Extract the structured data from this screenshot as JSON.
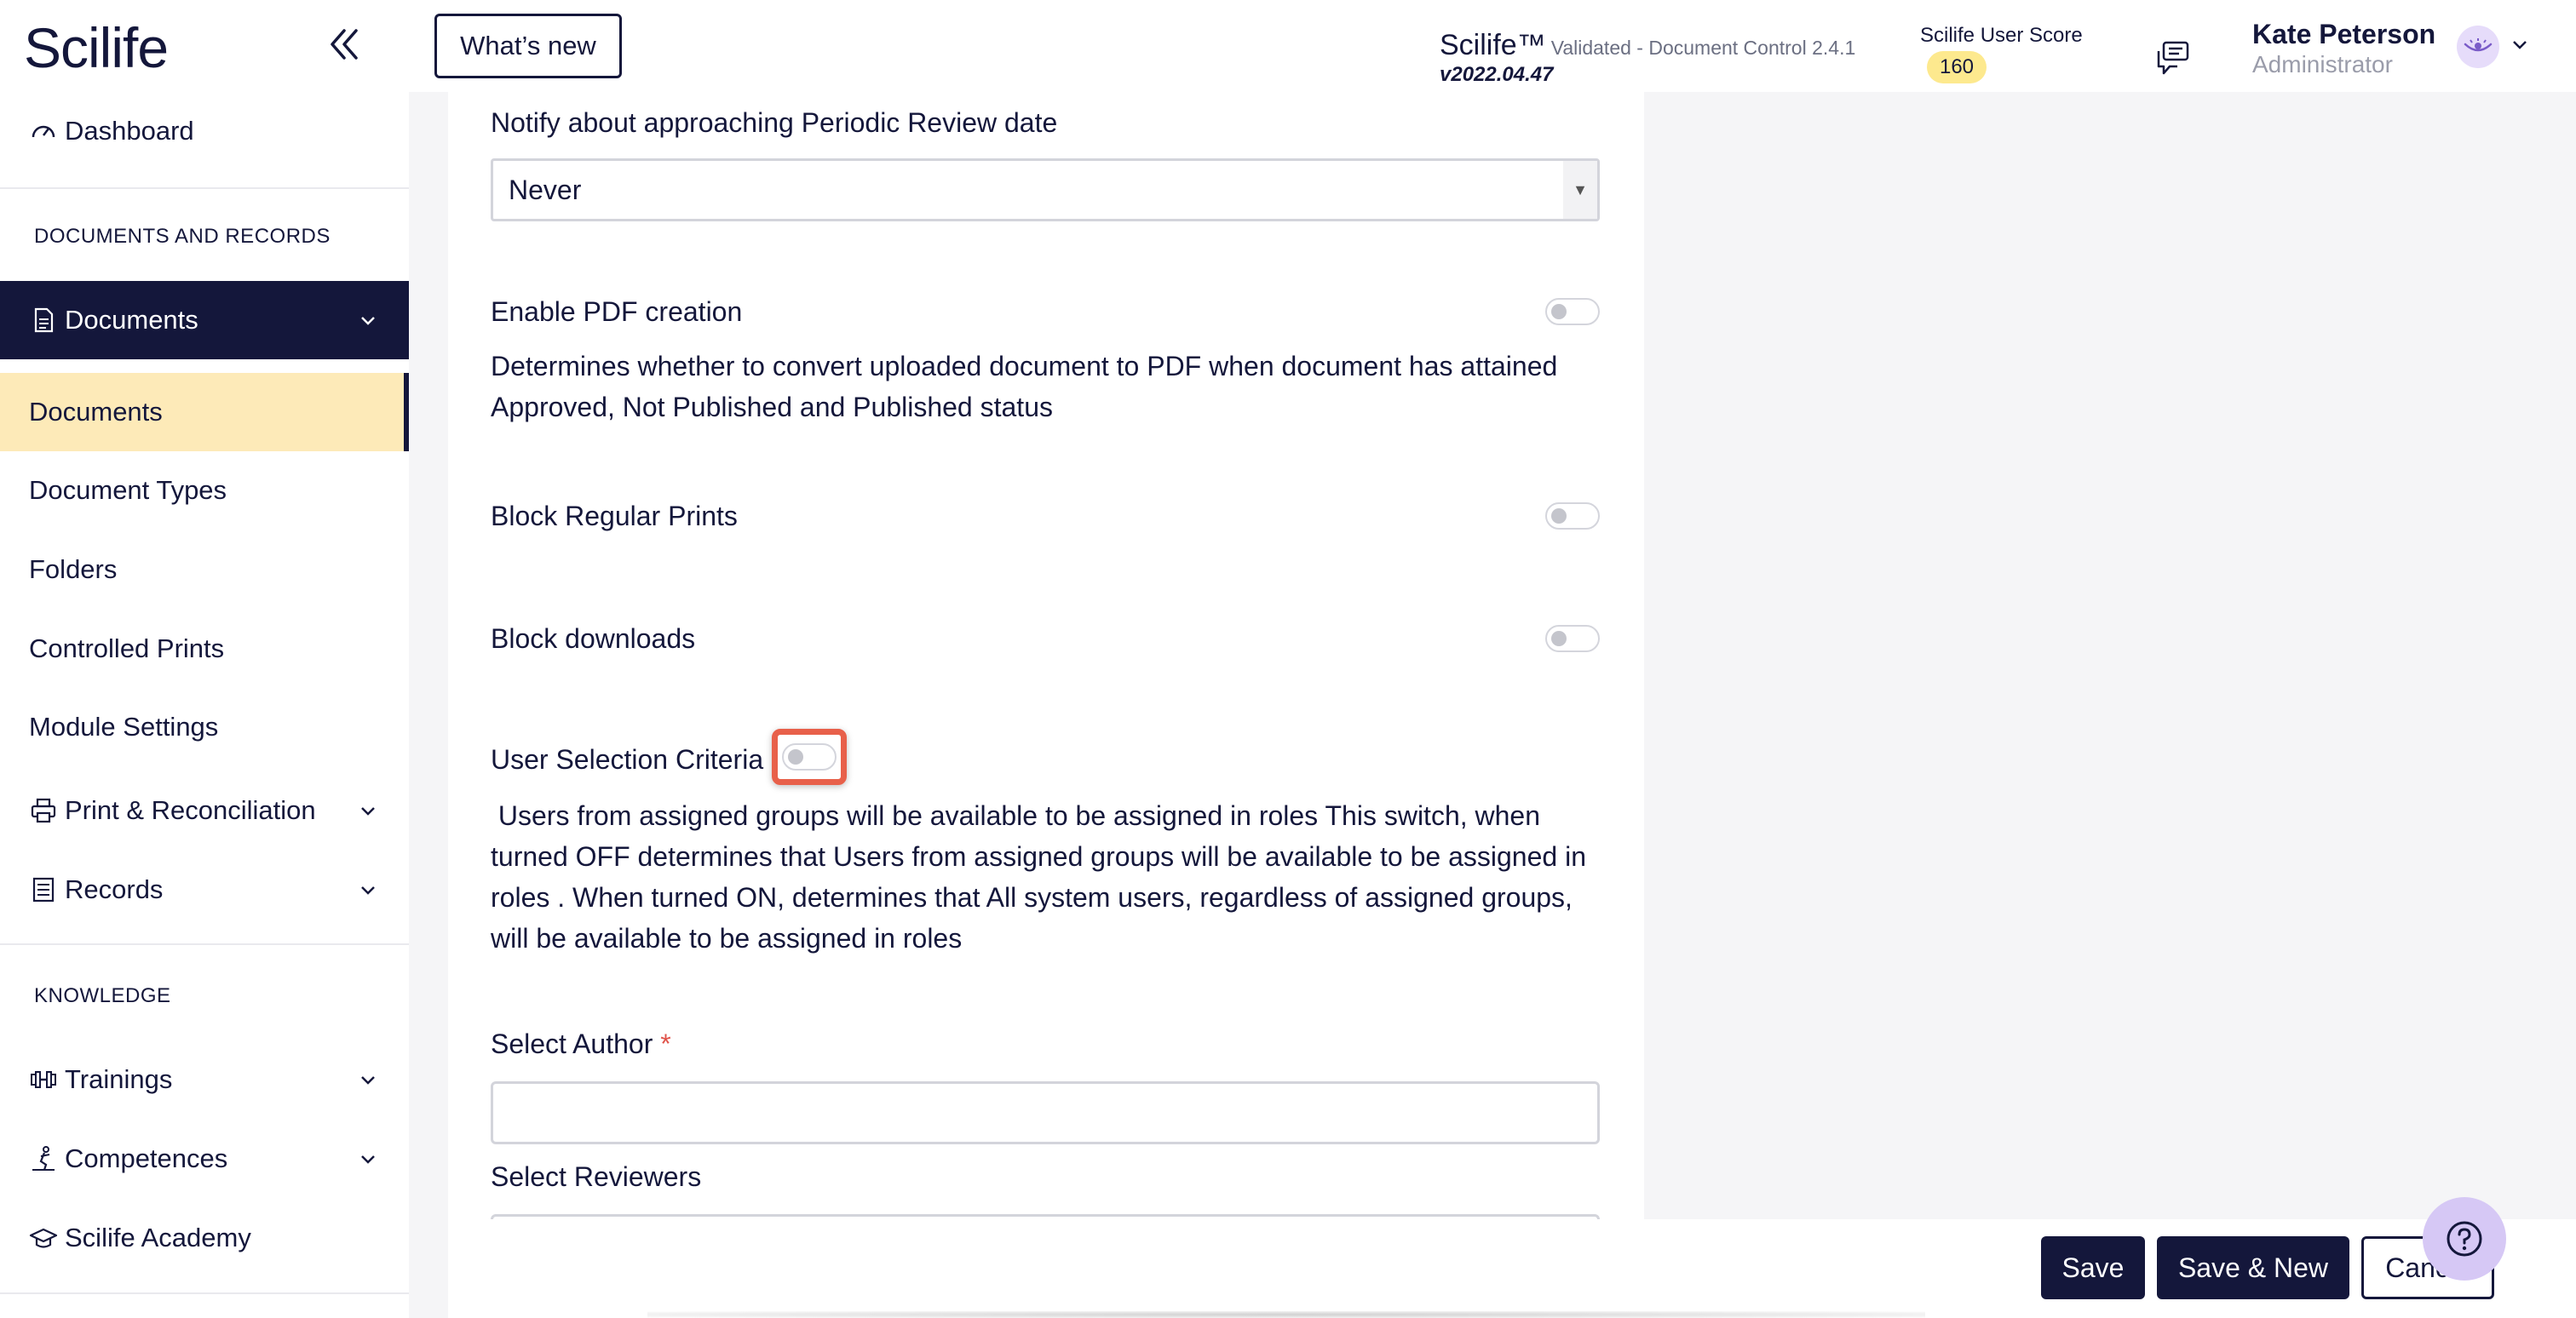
{
  "header": {
    "logo": "Scilife",
    "whats_new": "What’s new",
    "product_name": "Scilife™",
    "product_sub": "Validated - Document Control 2.4.1",
    "version": "v2022.04.47",
    "score_label": "Scilife User Score",
    "score_value": "160",
    "user_name": "Kate Peterson",
    "user_role": "Administrator"
  },
  "sidebar": {
    "dashboard": "Dashboard",
    "section_docs": "DOCUMENTS AND RECORDS",
    "documents_group": "Documents",
    "sub_items": [
      "Documents",
      "Document Types",
      "Folders",
      "Controlled Prints",
      "Module Settings"
    ],
    "print_reconciliation": "Print & Reconciliation",
    "records": "Records",
    "section_knowledge": "KNOWLEDGE",
    "trainings": "Trainings",
    "competences": "Competences",
    "academy": "Scilife Academy"
  },
  "form": {
    "periodic_review_label": "Notify about approaching Periodic Review date",
    "periodic_review_value": "Never",
    "pdf_label": "Enable PDF creation",
    "pdf_desc": "Determines whether to convert uploaded document to PDF when document has attained Approved, Not Published and Published status",
    "block_prints_label": "Block Regular Prints",
    "block_downloads_label": "Block downloads",
    "user_selection_label": "User Selection Criteria",
    "user_selection_desc": " Users from assigned groups will be available to be assigned in roles This switch, when turned OFF determines that Users from assigned groups will be available to be assigned in roles . When turned ON, determines that All system users, regardless of assigned groups, will be available to be assigned in roles",
    "author_label": "Select Author",
    "required_mark": "*",
    "reviewers_label": "Select Reviewers"
  },
  "footer": {
    "save": "Save",
    "save_new": "Save & New",
    "cancel": "Cancel"
  },
  "colors": {
    "navy": "#14173b",
    "active_bg": "#fdeab8",
    "highlight": "#e8604a",
    "score_badge": "#fde98e"
  }
}
